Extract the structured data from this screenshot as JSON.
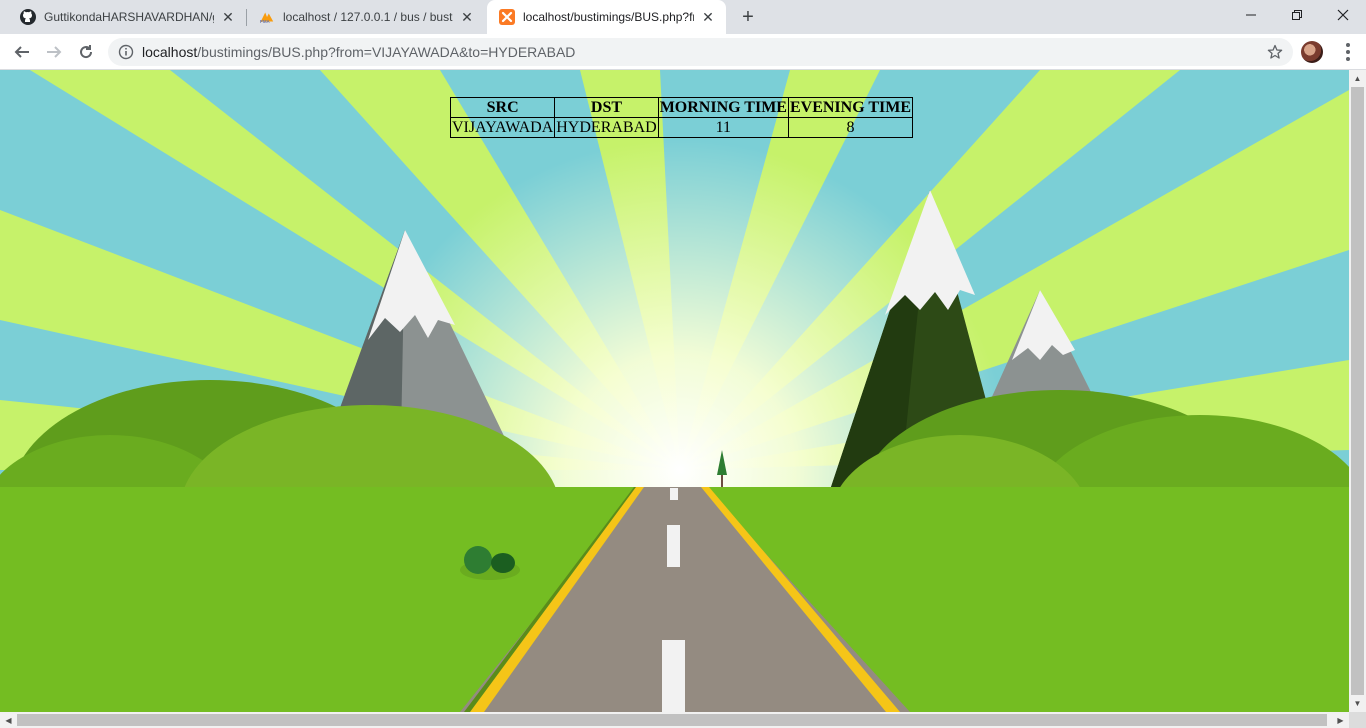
{
  "tabs": [
    {
      "title": "GuttikondaHARSHAVARDHAN/gu",
      "icon": "github-icon",
      "active": false
    },
    {
      "title": "localhost / 127.0.0.1 / bus / busti",
      "icon": "phpmyadmin-icon",
      "active": false
    },
    {
      "title": "localhost/bustimings/BUS.php?fr",
      "icon": "xampp-icon",
      "active": true
    }
  ],
  "toolbar": {
    "url_host": "localhost",
    "url_path": "/bustimings/BUS.php?from=VIJAYAWADA&to=HYDERABAD"
  },
  "table": {
    "headers": [
      "SRC",
      "DST",
      "MORNING TIME",
      "EVENING TIME"
    ],
    "rows": [
      [
        "VIJAYAWADA",
        "HYDERABAD",
        "11",
        "8"
      ]
    ]
  },
  "colors": {
    "sky": "#7bcfd6",
    "rays": "#c6f26a",
    "grass": "#74bd22",
    "road": "#948b81",
    "road_edge": "#f5c518"
  }
}
